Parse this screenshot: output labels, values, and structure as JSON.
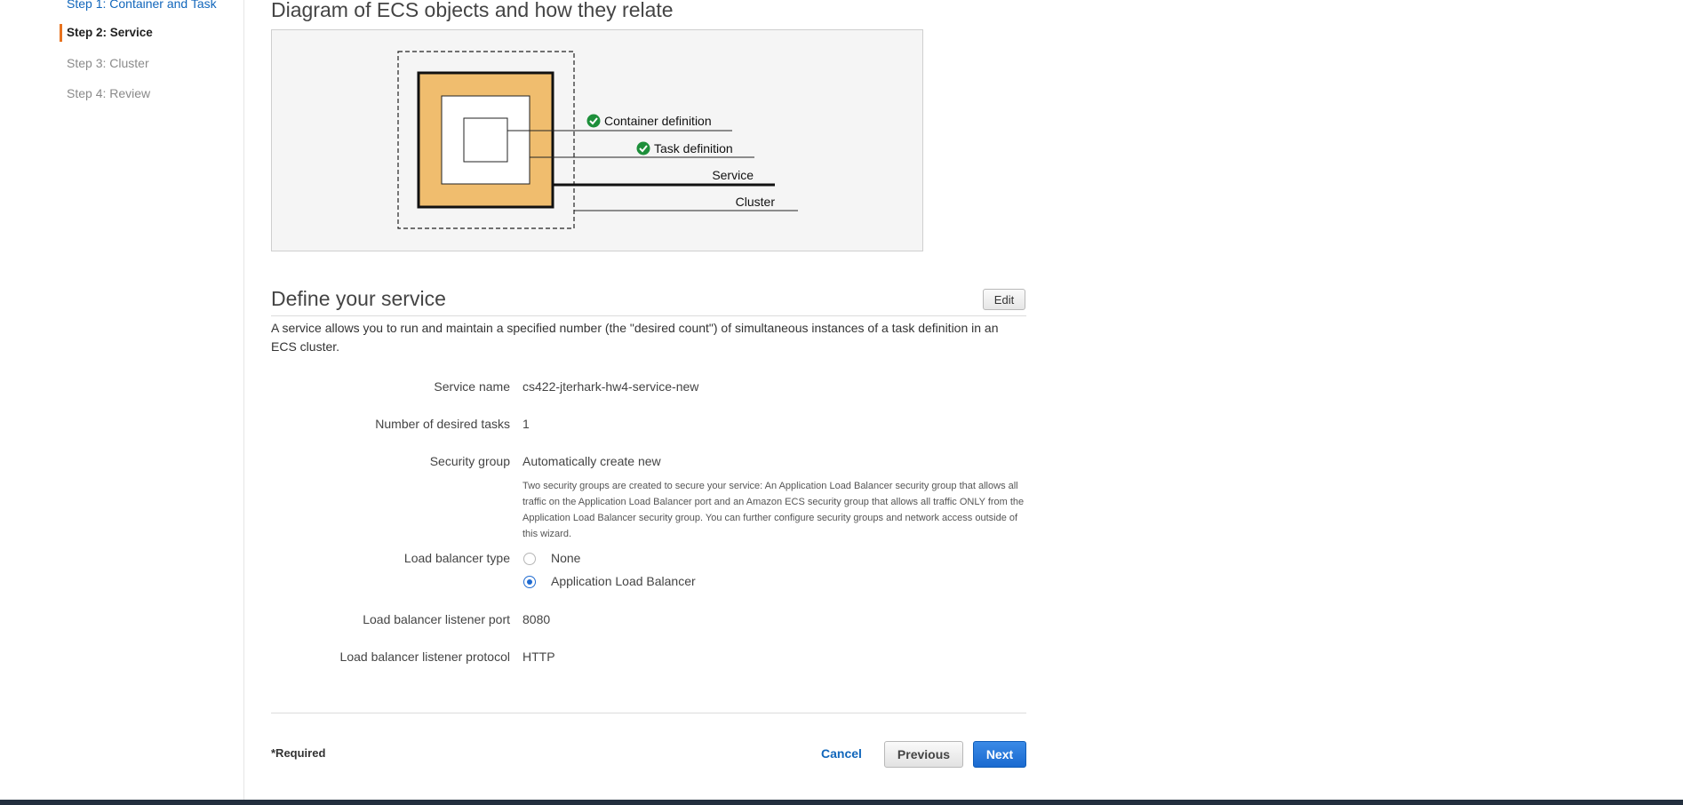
{
  "sidebar": {
    "steps": [
      {
        "label": "Step 1: Container and Task",
        "state": "link"
      },
      {
        "label": "Step 2: Service",
        "state": "active"
      },
      {
        "label": "Step 3: Cluster",
        "state": "disabled"
      },
      {
        "label": "Step 4: Review",
        "state": "disabled"
      }
    ]
  },
  "diagram": {
    "title": "Diagram of ECS objects and how they relate",
    "labels": {
      "container_definition": "Container definition",
      "task_definition": "Task definition",
      "service": "Service",
      "cluster": "Cluster"
    },
    "colors": {
      "service_fill": "#f0bd6e",
      "check": "#1d8f3a"
    },
    "icons": [
      "check-circle-icon",
      "check-circle-icon"
    ]
  },
  "service_section": {
    "title": "Define your service",
    "edit_label": "Edit",
    "description": "A service allows you to run and maintain a specified number (the \"desired count\") of simultaneous instances of a task definition in an ECS cluster.",
    "fields": {
      "service_name": {
        "label": "Service name",
        "value": "cs422-jterhark-hw4-service-new"
      },
      "desired_tasks": {
        "label": "Number of desired tasks",
        "value": "1"
      },
      "security_group": {
        "label": "Security group",
        "value": "Automatically create new",
        "help": "Two security groups are created to secure your service: An Application Load Balancer security group that allows all traffic on the Application Load Balancer port and an Amazon ECS security group that allows all traffic ONLY from the Application Load Balancer security group. You can further configure security groups and network access outside of this wizard."
      },
      "lb_type": {
        "label": "Load balancer type",
        "options": [
          {
            "label": "None",
            "selected": false
          },
          {
            "label": "Application Load Balancer",
            "selected": true
          }
        ]
      },
      "lb_port": {
        "label": "Load balancer listener port",
        "value": "8080"
      },
      "lb_protocol": {
        "label": "Load balancer listener protocol",
        "value": "HTTP"
      }
    }
  },
  "footer": {
    "required_label": "*Required",
    "cancel_label": "Cancel",
    "previous_label": "Previous",
    "next_label": "Next"
  },
  "colors": {
    "accent": "#1166bb",
    "active_step_marker": "#e8731f",
    "primary_button": "#1a6ad0"
  }
}
